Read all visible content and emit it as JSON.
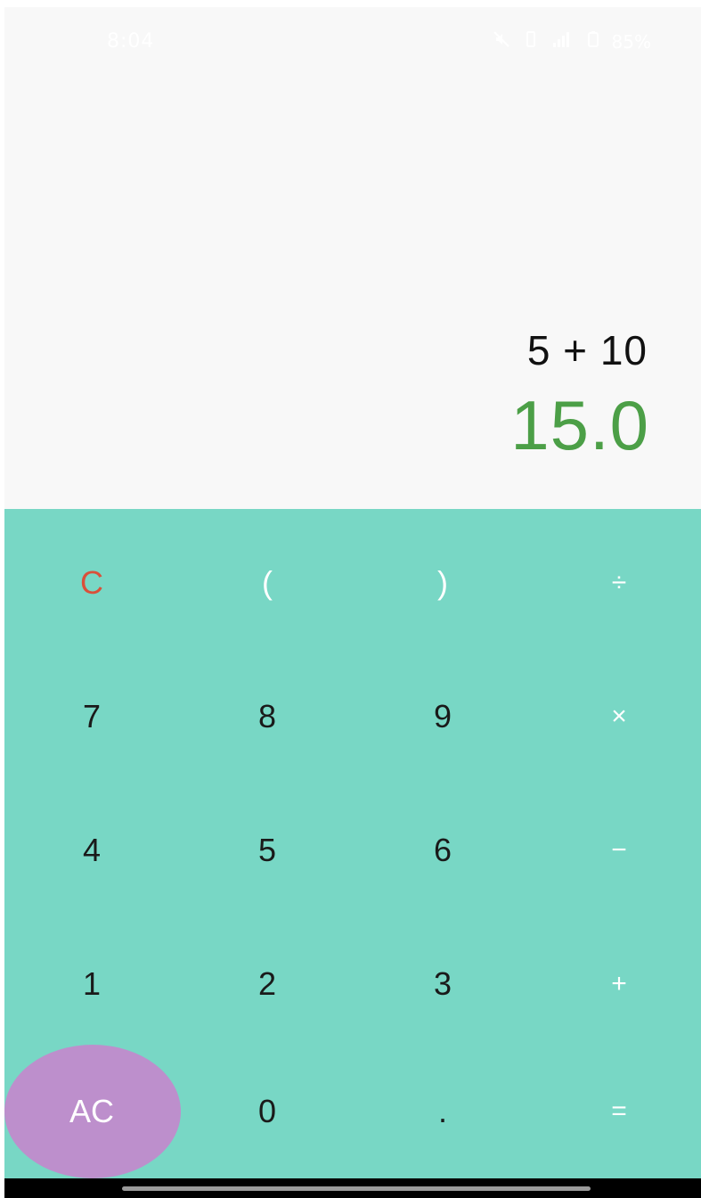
{
  "status_bar": {
    "time": "8:04",
    "icons": [
      "mute-icon",
      "vibrate-icon",
      "signal-icon",
      "battery-icon"
    ],
    "battery": "85%"
  },
  "display": {
    "expression": "5 + 10",
    "result": "15.0"
  },
  "keys": {
    "row1": [
      "C",
      "(",
      ")",
      "÷"
    ],
    "row2": [
      "7",
      "8",
      "9",
      "×"
    ],
    "row3": [
      "4",
      "5",
      "6",
      "−"
    ],
    "row4": [
      "1",
      "2",
      "3",
      "+"
    ],
    "row5": [
      "AC",
      "0",
      ".",
      "="
    ]
  },
  "colors": {
    "keypad_bg": "#78d7c5",
    "result_text": "#4c9f47",
    "clear_key": "#d9503a",
    "ac_bubble": "#bd8fcc",
    "display_bg": "#f8f8f8"
  }
}
